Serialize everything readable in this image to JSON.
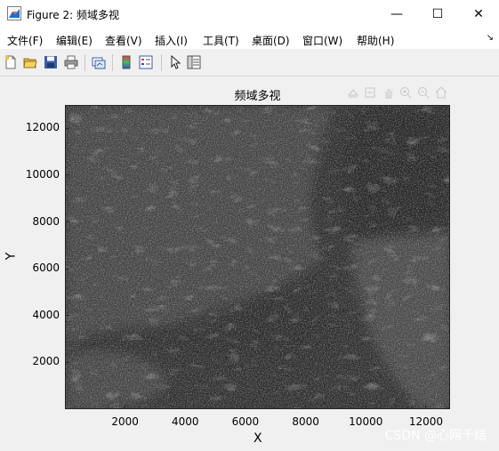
{
  "window": {
    "title": "Figure 2: 频域多视",
    "minimize_glyph": "—",
    "maximize_glyph": "☐",
    "close_glyph": "✕"
  },
  "menu": {
    "items": [
      "文件(F)",
      "编辑(E)",
      "查看(V)",
      "插入(I)",
      "工具(T)",
      "桌面(D)",
      "窗口(W)",
      "帮助(H)"
    ],
    "chevron": "↘"
  },
  "toolbar": {
    "icons": [
      "new-figure-icon",
      "open-file-icon",
      "save-icon",
      "print-icon",
      "link-plot-icon",
      "insert-colorbar-icon",
      "insert-legend-icon",
      "pointer-icon",
      "property-inspector-icon"
    ]
  },
  "axes_toolbar": {
    "icons": [
      "export-icon",
      "brush-icon",
      "pan-icon",
      "zoom-in-icon",
      "zoom-out-icon",
      "home-icon"
    ]
  },
  "chart_data": {
    "type": "heatmap",
    "title": "频域多视",
    "xlabel": "X",
    "ylabel": "Y",
    "xlim": [
      1,
      12800
    ],
    "ylim": [
      1,
      13000
    ],
    "x_ticks": [
      2000,
      4000,
      6000,
      8000,
      10000,
      12000
    ],
    "y_ticks": [
      2000,
      4000,
      6000,
      8000,
      10000,
      12000
    ],
    "colormap": "gray",
    "grid": false
  },
  "watermark": "CSDN @心网千结"
}
